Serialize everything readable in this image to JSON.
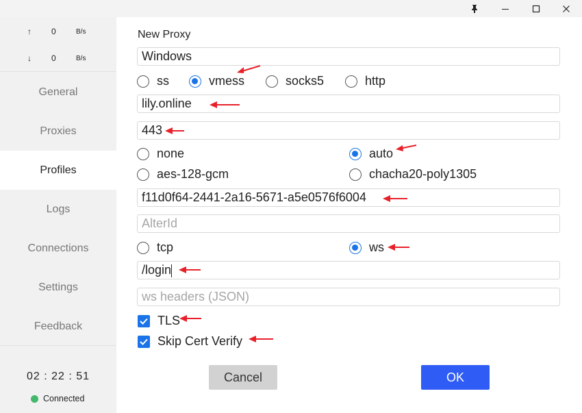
{
  "window": {
    "pin_icon": "pin-icon",
    "minimize_icon": "minimize-icon",
    "maximize_icon": "maximize-icon",
    "close_icon": "close-icon"
  },
  "sidebar": {
    "upload": {
      "arrow": "↑",
      "value": "0",
      "unit": "B/s"
    },
    "download": {
      "arrow": "↓",
      "value": "0",
      "unit": "B/s"
    },
    "items": [
      {
        "label": "General",
        "active": false
      },
      {
        "label": "Proxies",
        "active": false
      },
      {
        "label": "Profiles",
        "active": true
      },
      {
        "label": "Logs",
        "active": false
      },
      {
        "label": "Connections",
        "active": false
      },
      {
        "label": "Settings",
        "active": false
      },
      {
        "label": "Feedback",
        "active": false
      }
    ],
    "clock": "02 : 22 : 51",
    "status": "Connected",
    "status_color": "#44b86a"
  },
  "form": {
    "title": "New Proxy",
    "name_value": "Windows",
    "protocol_options": [
      "ss",
      "vmess",
      "socks5",
      "http"
    ],
    "protocol_selected": "vmess",
    "server_value": "lily.online",
    "port_value": "443",
    "security_options": [
      "none",
      "auto",
      "aes-128-gcm",
      "chacha20-poly1305"
    ],
    "security_selected": "auto",
    "uuid_value": "f11d0f64-2441-2a16-5671-a5e0576f6004",
    "alterid_placeholder": "AlterId",
    "network_options": [
      "tcp",
      "ws"
    ],
    "network_selected": "ws",
    "ws_path_value": "/login",
    "ws_headers_placeholder": "ws headers (JSON)",
    "tls_label": "TLS",
    "tls_checked": true,
    "skip_cert_label": "Skip Cert Verify",
    "skip_cert_checked": true
  },
  "buttons": {
    "cancel": "Cancel",
    "ok": "OK"
  },
  "colors": {
    "accent": "#1a73e8",
    "ok_button": "#2f5cf5",
    "annotation_arrow": "#e8202a"
  }
}
